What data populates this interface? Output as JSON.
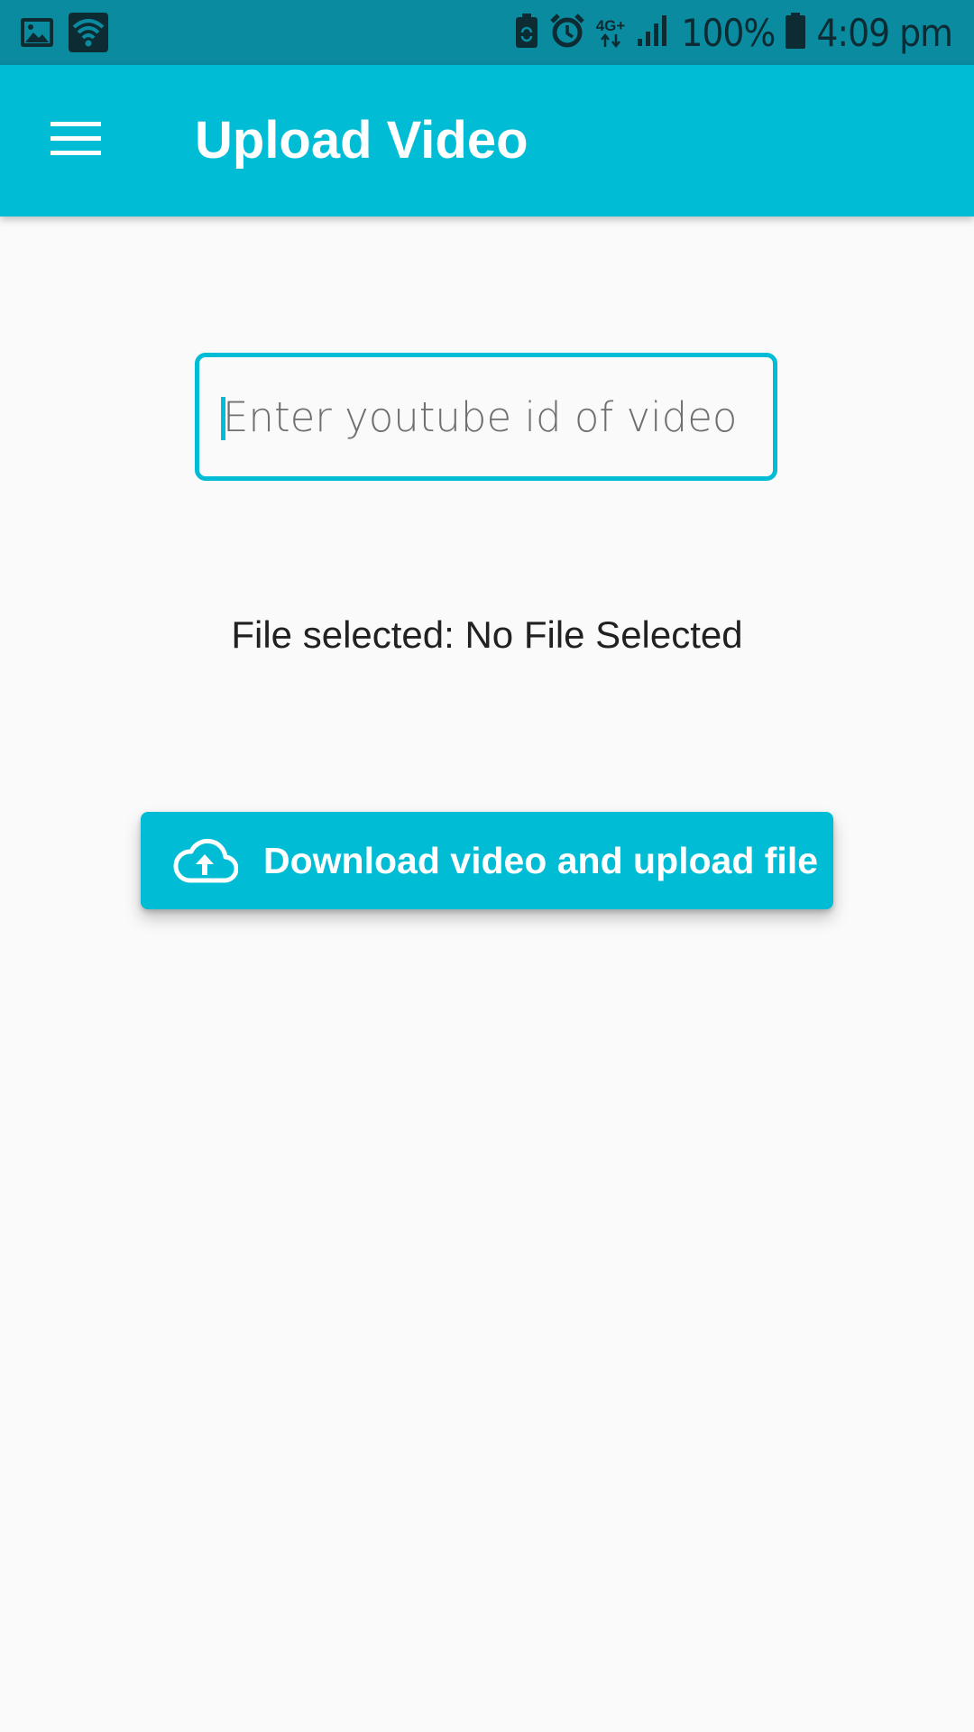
{
  "colors": {
    "status_bar": "#0a8ba0",
    "primary": "#00bcd4",
    "background": "#fafafa",
    "text": "#212121",
    "on_primary": "#ffffff"
  },
  "status_bar": {
    "left_icons": [
      "gallery-icon",
      "wifi-icon"
    ],
    "right_icons": [
      "battery-saver-icon",
      "alarm-icon",
      "network-4g-icon",
      "signal-icon",
      "battery-icon"
    ],
    "network_label": "4G+",
    "battery": "100%",
    "time": "4:09 pm"
  },
  "app_bar": {
    "menu_icon": "hamburger-menu-icon",
    "title": "Upload Video"
  },
  "form": {
    "video_id_value": "",
    "video_id_placeholder": "Enter youtube id of video",
    "file_status": "File selected: No File Selected",
    "upload_button_icon": "cloud-upload-icon",
    "upload_button_label": "Download video and upload file"
  }
}
